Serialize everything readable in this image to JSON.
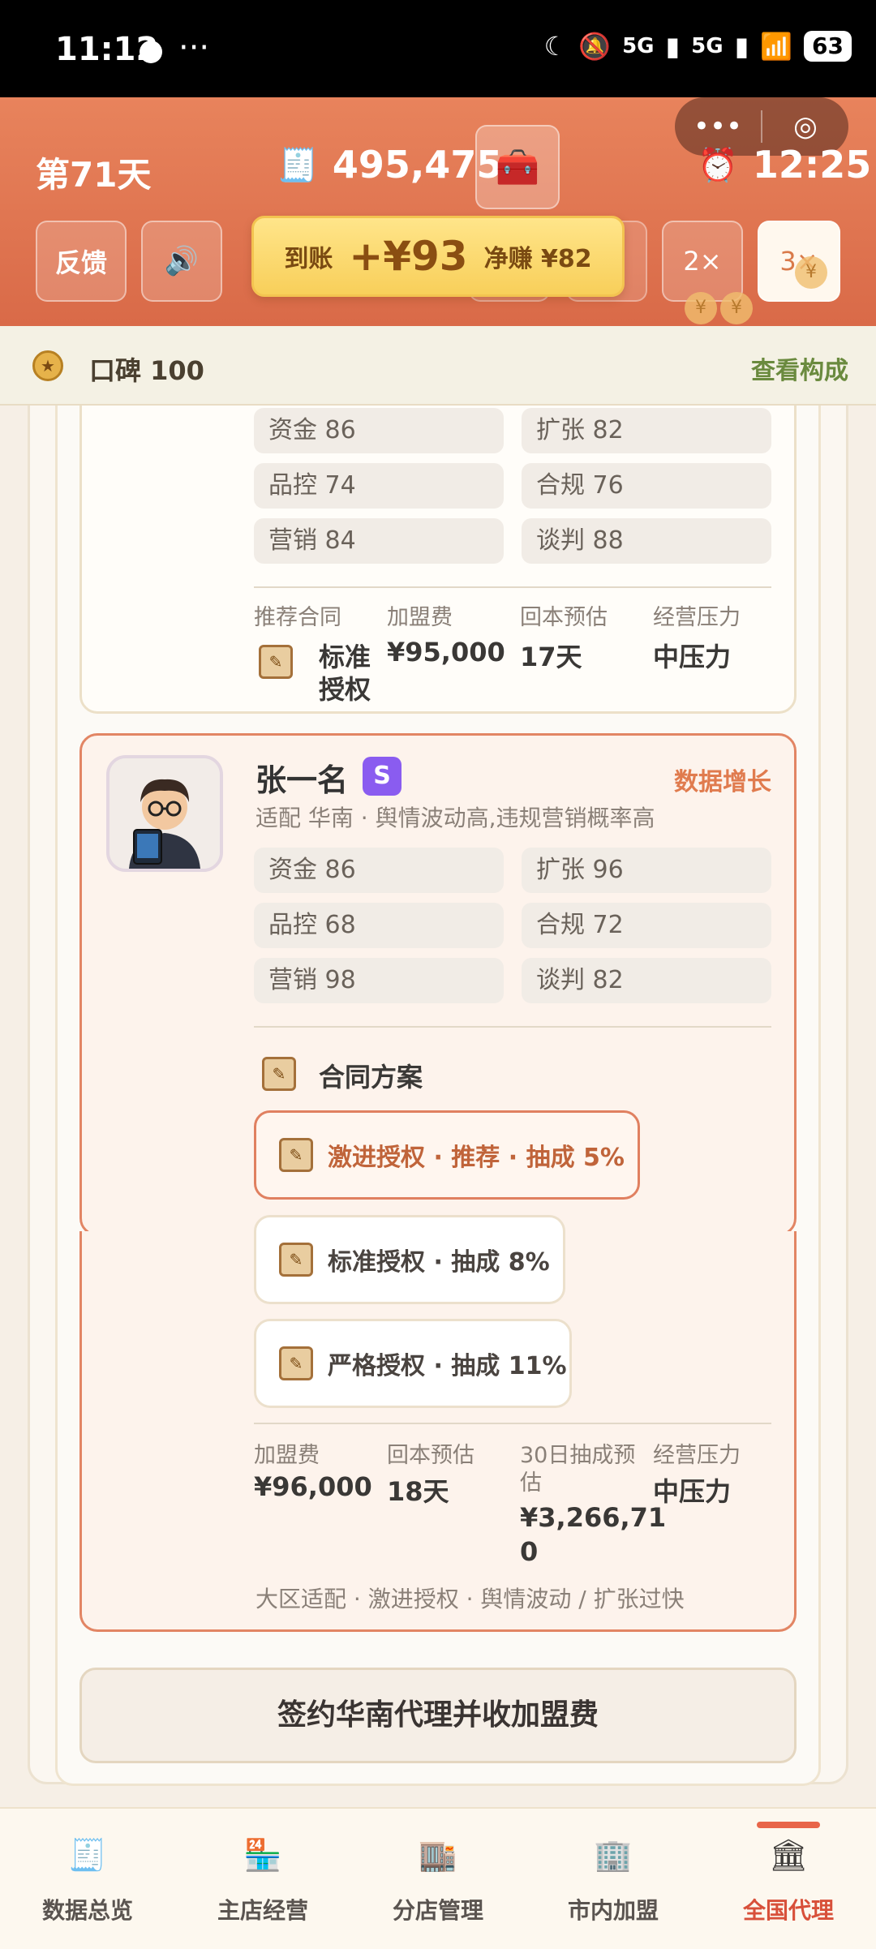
{
  "status_bar": {
    "time": "11:12",
    "more": "···",
    "network": "5G",
    "battery": "63"
  },
  "header": {
    "capsule_more": "•••",
    "capsule_target": "◎",
    "day": "第71天",
    "money": "495,475",
    "clock": "12:25",
    "feedback_label": "反馈",
    "sound_label": "🔊",
    "speed2": "2×",
    "speed3": "3×",
    "toast": {
      "label": "到账",
      "amount": "+¥93",
      "net": "净赚 ¥82"
    }
  },
  "reputation": {
    "text": "口碑 100",
    "link": "查看构成"
  },
  "card1": {
    "stats": [
      "资金 86",
      "扩张 82",
      "品控 74",
      "合规 76",
      "营销 84",
      "谈判 88"
    ],
    "columns": [
      {
        "label": "推荐合同",
        "value_line1": "标准",
        "value_line2": "授权"
      },
      {
        "label": "加盟费",
        "value": "¥95,000"
      },
      {
        "label": "回本预估",
        "value": "17天"
      },
      {
        "label": "经营压力",
        "value": "中压力"
      }
    ]
  },
  "card2": {
    "name": "张一名",
    "rank": "S",
    "tag": "数据增长",
    "desc": "适配 华南 · 舆情波动高,违规营销概率高",
    "stats": [
      "资金 86",
      "扩张 96",
      "品控 68",
      "合规 72",
      "营销 98",
      "谈判 82"
    ],
    "contract_title": "合同方案",
    "options": [
      "激进授权 · 推荐 · 抽成 5%",
      "标准授权 · 抽成 8%",
      "严格授权 · 抽成 11%"
    ],
    "columns": [
      {
        "label": "加盟费",
        "value": "¥96,000"
      },
      {
        "label": "回本预估",
        "value": "18天"
      },
      {
        "label_line1": "30日抽成预",
        "label_line2": "估",
        "value_line1": "¥3,266,71",
        "value_line2": "0"
      },
      {
        "label": "经营压力",
        "value": "中压力"
      }
    ],
    "footnote": "大区适配 · 激进授权 · 舆情波动 / 扩张过快"
  },
  "sign_button": "签约华南代理并收加盟费",
  "nav": [
    {
      "label": "数据总览",
      "icon": "cash-register-icon"
    },
    {
      "label": "主店经营",
      "icon": "shop-icon"
    },
    {
      "label": "分店管理",
      "icon": "branch-store-icon"
    },
    {
      "label": "市内加盟",
      "icon": "city-franchise-icon"
    },
    {
      "label": "全国代理",
      "icon": "national-agent-icon"
    }
  ],
  "colors": {
    "header": "#e07a52",
    "accent": "#d8503a",
    "selected_border": "#e08060"
  }
}
